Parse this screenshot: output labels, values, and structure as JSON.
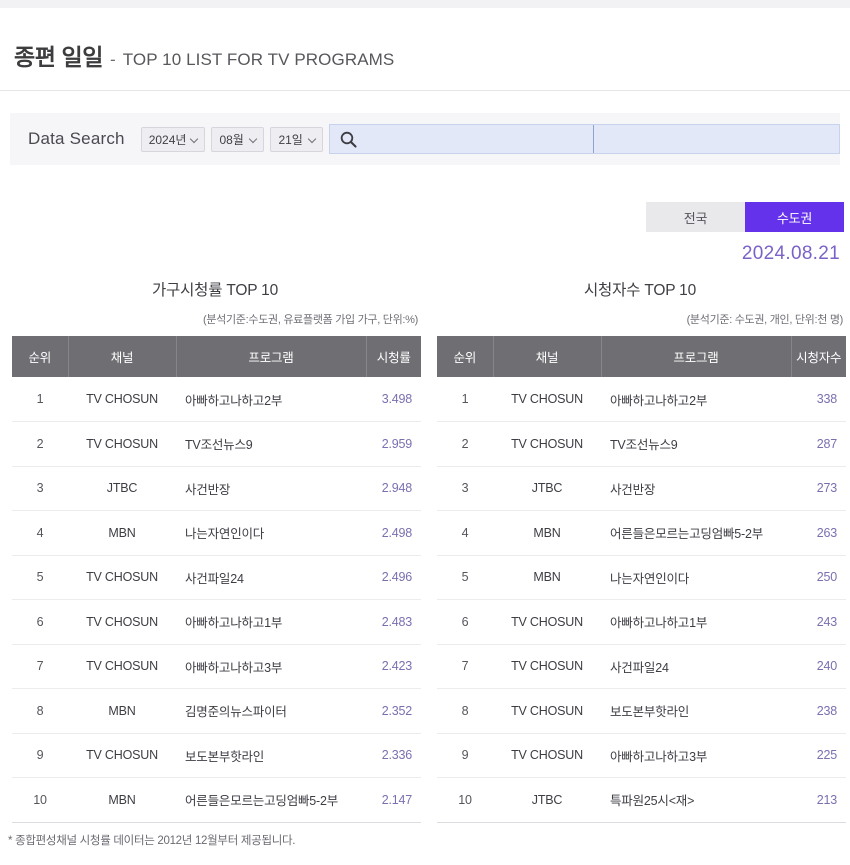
{
  "header": {
    "title_kr": "종편 일일",
    "dash": "-",
    "title_en": "TOP 10 LIST FOR TV PROGRAMS"
  },
  "search": {
    "label": "Data Search",
    "year": "2024년",
    "month": "08월",
    "day": "21일",
    "icon": "search-icon",
    "input_a_value": "",
    "input_a_placeholder": "",
    "input_b_value": "",
    "input_b_placeholder": ""
  },
  "region_toggle": {
    "nationwide": "전국",
    "metro": "수도권",
    "active": "수도권",
    "active_color": "#6432ea"
  },
  "date_label": "2024.08.21",
  "accent_color": "#7b6fb0",
  "footnote": "* 종합편성채널 시청률 데이터는 2012년 12월부터 제공됩니다.",
  "tables": {
    "household": {
      "title": "가구시청률 TOP 10",
      "subtitle": "(분석기준:수도권, 유료플랫폼 가입 가구, 단위:%)",
      "columns": [
        "순위",
        "채널",
        "프로그램",
        "시청률"
      ],
      "rows": [
        {
          "rank": "1",
          "channel": "TV CHOSUN",
          "program": "아빠하고나하고2부",
          "value": "3.498"
        },
        {
          "rank": "2",
          "channel": "TV CHOSUN",
          "program": "TV조선뉴스9",
          "value": "2.959"
        },
        {
          "rank": "3",
          "channel": "JTBC",
          "program": "사건반장",
          "value": "2.948"
        },
        {
          "rank": "4",
          "channel": "MBN",
          "program": "나는자연인이다",
          "value": "2.498"
        },
        {
          "rank": "5",
          "channel": "TV CHOSUN",
          "program": "사건파일24",
          "value": "2.496"
        },
        {
          "rank": "6",
          "channel": "TV CHOSUN",
          "program": "아빠하고나하고1부",
          "value": "2.483"
        },
        {
          "rank": "7",
          "channel": "TV CHOSUN",
          "program": "아빠하고나하고3부",
          "value": "2.423"
        },
        {
          "rank": "8",
          "channel": "MBN",
          "program": "김명준의뉴스파이터",
          "value": "2.352"
        },
        {
          "rank": "9",
          "channel": "TV CHOSUN",
          "program": "보도본부핫라인",
          "value": "2.336"
        },
        {
          "rank": "10",
          "channel": "MBN",
          "program": "어른들은모르는고딩엄빠5-2부",
          "value": "2.147"
        }
      ]
    },
    "viewers": {
      "title": "시청자수 TOP 10",
      "subtitle": "(분석기준: 수도권, 개인, 단위:천 명)",
      "columns": [
        "순위",
        "채널",
        "프로그램",
        "시청자수"
      ],
      "rows": [
        {
          "rank": "1",
          "channel": "TV CHOSUN",
          "program": "아빠하고나하고2부",
          "value": "338"
        },
        {
          "rank": "2",
          "channel": "TV CHOSUN",
          "program": "TV조선뉴스9",
          "value": "287"
        },
        {
          "rank": "3",
          "channel": "JTBC",
          "program": "사건반장",
          "value": "273"
        },
        {
          "rank": "4",
          "channel": "MBN",
          "program": "어른들은모르는고딩엄빠5-2부",
          "value": "263"
        },
        {
          "rank": "5",
          "channel": "MBN",
          "program": "나는자연인이다",
          "value": "250"
        },
        {
          "rank": "6",
          "channel": "TV CHOSUN",
          "program": "아빠하고나하고1부",
          "value": "243"
        },
        {
          "rank": "7",
          "channel": "TV CHOSUN",
          "program": "사건파일24",
          "value": "240"
        },
        {
          "rank": "8",
          "channel": "TV CHOSUN",
          "program": "보도본부핫라인",
          "value": "238"
        },
        {
          "rank": "9",
          "channel": "TV CHOSUN",
          "program": "아빠하고나하고3부",
          "value": "225"
        },
        {
          "rank": "10",
          "channel": "JTBC",
          "program": "특파원25시<재>",
          "value": "213"
        }
      ]
    }
  }
}
